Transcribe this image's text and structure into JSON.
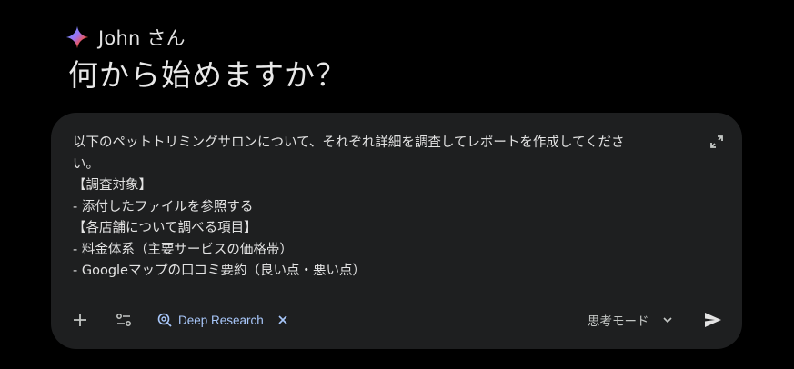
{
  "greeting": {
    "text": "John さん"
  },
  "headline": "何から始めますか？",
  "composer": {
    "prompt_lines": [
      "以下のペットトリミングサロンについて、それぞれ詳細を調査してレポートを作成してくださ",
      "い。",
      "【調査対象】",
      "- 添付したファイルを参照する",
      "【各店舗について調べる項目】",
      "- 料金体系（主要サービスの価格帯）",
      "- Googleマップの口コミ要約（良い点・悪い点）"
    ],
    "chip_label": "Deep Research",
    "mode_label": "思考モード"
  },
  "icons": {
    "brand": "gemini-spark-icon",
    "expand": "expand-icon",
    "add": "plus-icon",
    "tools": "tools-icon",
    "chip": "deep-research-icon",
    "chip_close": "close-icon",
    "mode": "chevron-down-icon",
    "send": "send-icon"
  },
  "colors": {
    "background": "#000000",
    "composer_bg": "#1e1f20",
    "chip_accent": "#a8c7fa",
    "text": "#e3e3e3"
  }
}
